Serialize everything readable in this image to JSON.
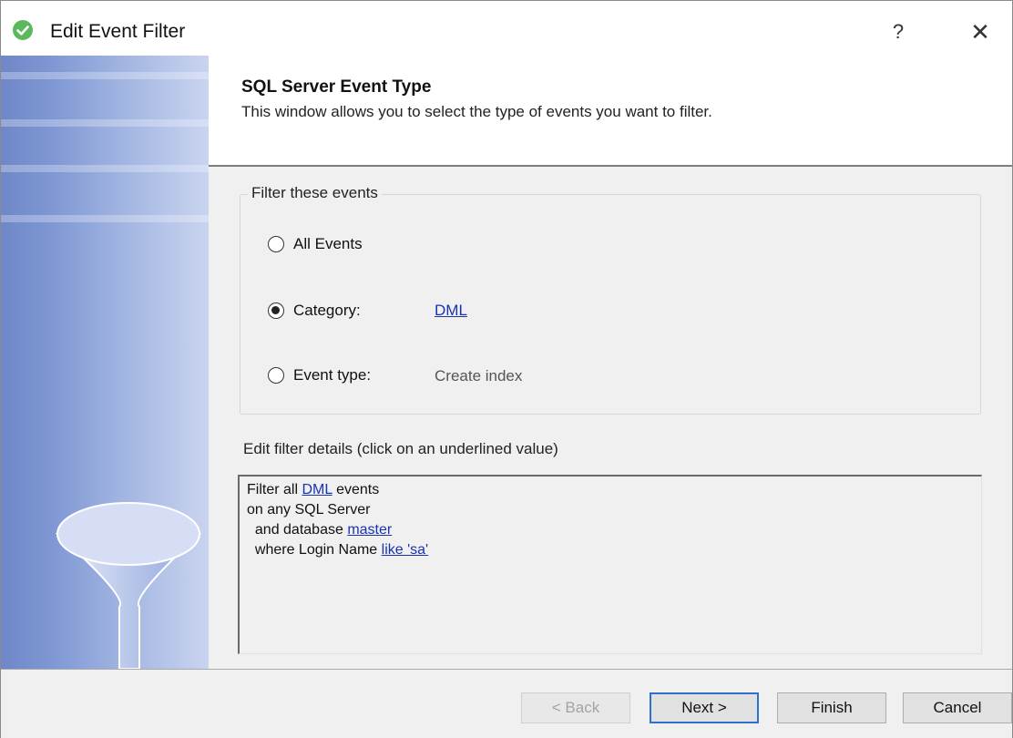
{
  "window": {
    "title": "Edit Event Filter",
    "help_label": "?",
    "close_label": "✕"
  },
  "header": {
    "title": "SQL Server Event Type",
    "subtitle": "This window allows you to select the type of events you want to filter."
  },
  "filter_group": {
    "legend": "Filter these events",
    "options": [
      {
        "label": "All Events",
        "checked": false
      },
      {
        "label": "Category:",
        "checked": true,
        "value": "DML"
      },
      {
        "label": "Event type:",
        "checked": false,
        "value": "Create index"
      }
    ]
  },
  "details": {
    "label": "Edit filter details (click on an underlined value)",
    "line1_pre": "Filter all ",
    "line1_link": "DML",
    "line1_post": " events",
    "line2": "on any SQL Server",
    "line3_pre": "  and database ",
    "line3_link": "master",
    "line4_pre": "  where Login Name ",
    "line4_link": "like 'sa'"
  },
  "footer": {
    "back_label": "< Back",
    "next_label": "Next >",
    "finish_label": "Finish",
    "cancel_label": "Cancel"
  },
  "colors": {
    "accent_link": "#1a33b0",
    "side_panel": "#7f98d4",
    "default_button_border": "#2f6fd0"
  },
  "icons": {
    "app": "green-check-circle-icon",
    "side": "funnel-icon"
  }
}
